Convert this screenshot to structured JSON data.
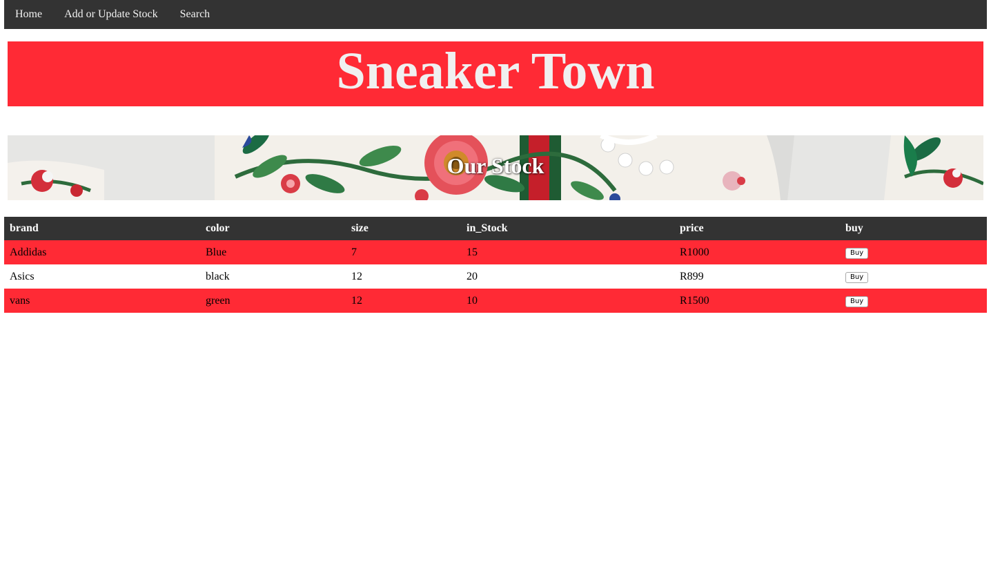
{
  "nav": {
    "items": [
      {
        "label": "Home"
      },
      {
        "label": "Add or Update Stock"
      },
      {
        "label": "Search"
      }
    ]
  },
  "banner": {
    "title": "Sneaker Town",
    "bg_color": "#ff2a35"
  },
  "hero": {
    "title": "Our Stock"
  },
  "table": {
    "headers": [
      "brand",
      "color",
      "size",
      "in_Stock",
      "price",
      "buy"
    ],
    "rows": [
      {
        "brand": "Addidas",
        "color": "Blue",
        "size": "7",
        "in_stock": "15",
        "price": "R1000",
        "buy_label": "Buy"
      },
      {
        "brand": "Asics",
        "color": "black",
        "size": "12",
        "in_stock": "20",
        "price": "R899",
        "buy_label": "Buy"
      },
      {
        "brand": "vans",
        "color": "green",
        "size": "12",
        "in_stock": "10",
        "price": "R1500",
        "buy_label": "Buy"
      }
    ]
  },
  "colors": {
    "nav_bg": "#333333",
    "accent_red": "#ff2a35",
    "text_light": "#f2f2f2"
  }
}
